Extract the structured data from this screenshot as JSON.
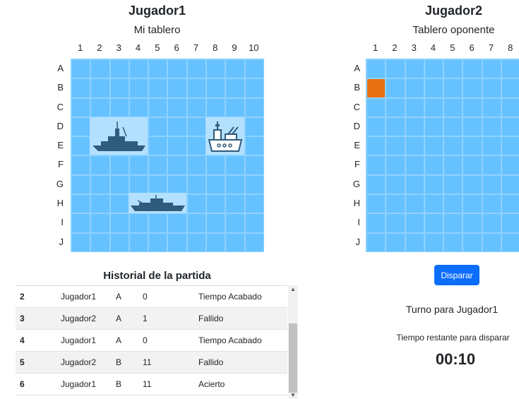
{
  "player1": {
    "name": "Jugador1",
    "board_title": "Mi tablero",
    "columns": [
      "1",
      "2",
      "3",
      "4",
      "5",
      "6",
      "7",
      "8",
      "9",
      "10"
    ],
    "rows": [
      "A",
      "B",
      "C",
      "D",
      "E",
      "F",
      "G",
      "H",
      "I",
      "J"
    ]
  },
  "player2": {
    "name": "Jugador2",
    "board_title": "Tablero oponente",
    "columns": [
      "1",
      "2",
      "3",
      "4",
      "5",
      "6",
      "7",
      "8"
    ],
    "rows": [
      "A",
      "B",
      "C",
      "D",
      "E",
      "F",
      "G",
      "H",
      "I",
      "J"
    ]
  },
  "history": {
    "title": "Historial de la partida",
    "rows": [
      {
        "num": "2",
        "player": "Jugador1",
        "row": "A",
        "col": "0",
        "result": "Tiempo Acabado"
      },
      {
        "num": "3",
        "player": "Jugador2",
        "row": "A",
        "col": "1",
        "result": "Fallido"
      },
      {
        "num": "4",
        "player": "Jugador1",
        "row": "A",
        "col": "0",
        "result": "Tiempo Acabado"
      },
      {
        "num": "5",
        "player": "Jugador2",
        "row": "B",
        "col": "11",
        "result": "Fallido"
      },
      {
        "num": "6",
        "player": "Jugador1",
        "row": "B",
        "col": "11",
        "result": "Acierto"
      }
    ]
  },
  "actions": {
    "fire_label": "Disparar"
  },
  "turn": {
    "text": "Turno para Jugador1",
    "time_label": "Tiempo restante para disparar",
    "time_value": "00:10"
  },
  "colors": {
    "water": "#66c2ff",
    "hit": "#e87211",
    "button": "#0d6efd"
  }
}
